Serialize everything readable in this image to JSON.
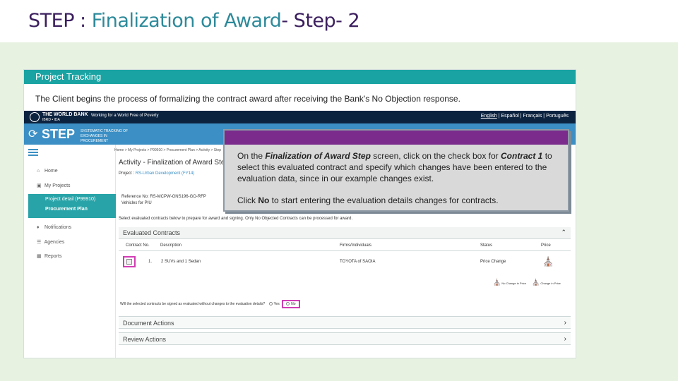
{
  "slide": {
    "title_prefix": "STEP : ",
    "title_highlight": "Finalization of Award",
    "title_suffix": "- Step- 2"
  },
  "project_tracking": {
    "header": "Project Tracking",
    "intro": "The Client begins the process of formalizing the contract award after receiving the Bank's No Objection response."
  },
  "worldbank_bar": {
    "name": "THE WORLD BANK",
    "subtitle": "IBRD • IDA",
    "tagline": "Working for a World Free of Poverty",
    "languages": [
      "English",
      "|",
      "Español",
      "|",
      "Français",
      "|",
      "Português"
    ]
  },
  "step_bar": {
    "logo": "STEP",
    "logo_subtitle": "SYSTEMATIC TRACKING OF EXCHANGES IN PROCUREMENT"
  },
  "sidebar": {
    "items": [
      {
        "label": "Home",
        "icon": "home-icon"
      },
      {
        "label": "My Projects",
        "icon": "projects-icon"
      },
      {
        "label": "Notifications",
        "icon": "bell-icon"
      },
      {
        "label": "Agencies",
        "icon": "agencies-icon"
      },
      {
        "label": "Reports",
        "icon": "reports-icon"
      }
    ],
    "active_project": "Project detail (P99910)",
    "active_sub": "Procurement Plan"
  },
  "main": {
    "breadcrumb": "Home > My Projects > P99910 > Procurement Plan > Activity > Step",
    "activity_title": "Activity - Finalization of Award Step",
    "project_label": "Project : ",
    "project_link": "RS-Urban Development (FY14)",
    "reference": "Reference No: RS-MCPW-GNS196-GO-RFP",
    "reference_desc": "Vehicles for PIU",
    "select_note": "Select evaluated contracts below to prepare for award and signing. Only No Objected Contracts can be processed for award.",
    "evaluated_contracts_header": "Evaluated Contracts",
    "columns": [
      "Contract No.",
      "Description",
      "Firms/Individuals",
      "Status",
      "Price"
    ],
    "rows": [
      {
        "number": "1.",
        "description": "2 SUVs and 1 Sedan",
        "firm": "TOYOTA of SAOIA",
        "status": "Price Change"
      }
    ],
    "legend": [
      "No Change in Price",
      "Change in Price"
    ],
    "question": "Will the selected contracts be signed as evaluated without changes to the evaluation details?",
    "yes_label": "Yes",
    "no_label": "No",
    "document_actions": "Document Actions",
    "review_actions": "Review Actions"
  },
  "callout": {
    "line1_pre": "On the ",
    "line1_em": "Finalization of Award Step",
    "line1_mid": " screen, click on the check box for ",
    "line1_em2": "Contract 1",
    "line1_post": " to select this evaluated contract and specify which changes have been entered to the evaluation data, since in our example changes exist.",
    "line2_pre": "Click ",
    "line2_em": "No",
    "line2_post": " to start entering the evaluation details changes for contracts."
  }
}
